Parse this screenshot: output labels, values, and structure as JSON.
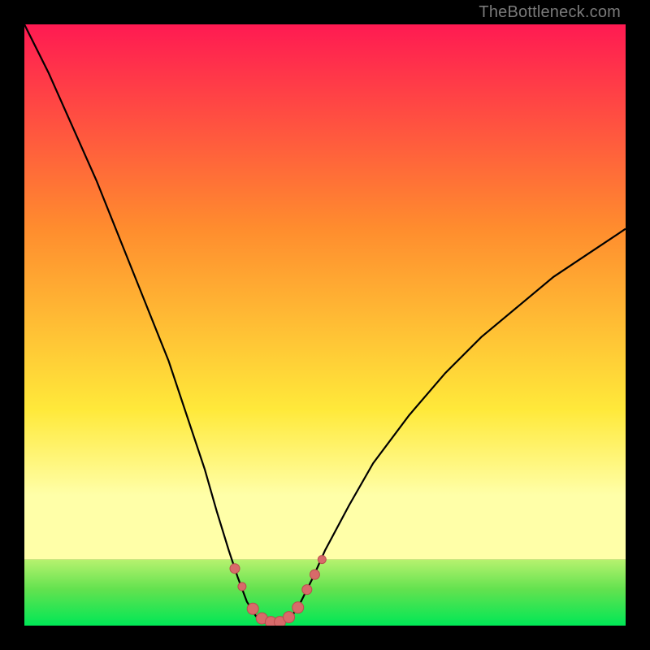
{
  "attribution": "TheBottleneck.com",
  "colors": {
    "frame": "#000000",
    "band_green": "#00e756",
    "band_green_mid": "#63e24f",
    "band_green_light": "#b7f26f",
    "curve": "#000000",
    "markers_fill": "#d86a6a",
    "markers_stroke": "#b94d4d",
    "gradient_top": "#ff1a52",
    "gradient_mid": "#ff8c2e",
    "gradient_low": "#ffe93a",
    "gradient_pale": "#ffffa8"
  },
  "chart_data": {
    "type": "line",
    "title": "",
    "xlabel": "",
    "ylabel": "",
    "xlim": [
      0,
      100
    ],
    "ylim": [
      0,
      100
    ],
    "curve": [
      {
        "x": 0,
        "y": 100
      },
      {
        "x": 4,
        "y": 92
      },
      {
        "x": 8,
        "y": 83
      },
      {
        "x": 12,
        "y": 74
      },
      {
        "x": 16,
        "y": 64
      },
      {
        "x": 20,
        "y": 54
      },
      {
        "x": 24,
        "y": 44
      },
      {
        "x": 27,
        "y": 35
      },
      {
        "x": 30,
        "y": 26
      },
      {
        "x": 32,
        "y": 19
      },
      {
        "x": 34,
        "y": 12.5
      },
      {
        "x": 35.5,
        "y": 8.0
      },
      {
        "x": 37,
        "y": 4.0
      },
      {
        "x": 38.5,
        "y": 1.6
      },
      {
        "x": 40,
        "y": 0.5
      },
      {
        "x": 41.5,
        "y": 0.2
      },
      {
        "x": 43,
        "y": 0.5
      },
      {
        "x": 44.5,
        "y": 1.6
      },
      {
        "x": 46,
        "y": 4.0
      },
      {
        "x": 48,
        "y": 8.0
      },
      {
        "x": 50,
        "y": 12.5
      },
      {
        "x": 54,
        "y": 20
      },
      {
        "x": 58,
        "y": 27
      },
      {
        "x": 64,
        "y": 35
      },
      {
        "x": 70,
        "y": 42
      },
      {
        "x": 76,
        "y": 48
      },
      {
        "x": 82,
        "y": 53
      },
      {
        "x": 88,
        "y": 58
      },
      {
        "x": 94,
        "y": 62
      },
      {
        "x": 100,
        "y": 66
      }
    ],
    "markers": [
      {
        "x": 35.0,
        "y": 9.5,
        "r": 6
      },
      {
        "x": 36.2,
        "y": 6.5,
        "r": 5
      },
      {
        "x": 38.0,
        "y": 2.8,
        "r": 7
      },
      {
        "x": 39.5,
        "y": 1.2,
        "r": 7
      },
      {
        "x": 41.0,
        "y": 0.6,
        "r": 7
      },
      {
        "x": 42.5,
        "y": 0.6,
        "r": 7
      },
      {
        "x": 44.0,
        "y": 1.4,
        "r": 7
      },
      {
        "x": 45.5,
        "y": 3.0,
        "r": 7
      },
      {
        "x": 47.0,
        "y": 6.0,
        "r": 6
      },
      {
        "x": 48.3,
        "y": 8.5,
        "r": 6
      },
      {
        "x": 49.5,
        "y": 11.0,
        "r": 5
      }
    ],
    "green_band": {
      "y_start": 0,
      "y_end": 11
    }
  }
}
